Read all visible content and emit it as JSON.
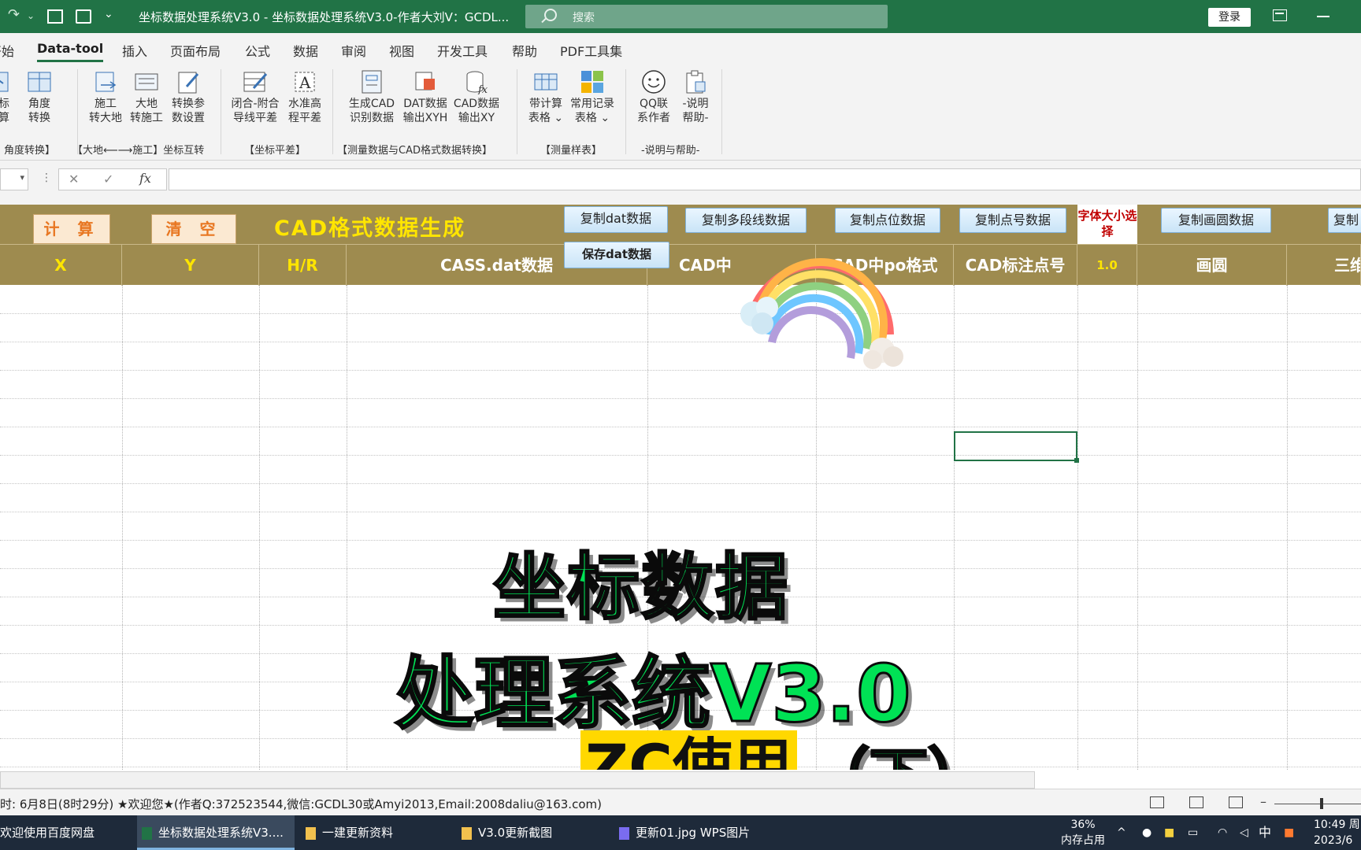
{
  "window": {
    "title": "坐标数据处理系统V3.0  -  坐标数据处理系统V3.0-作者大刘V：GCDL...",
    "search_placeholder": "搜索",
    "login_label": "登录"
  },
  "ribbon_tabs": [
    "开始",
    "Data-tool",
    "插入",
    "页面布局",
    "公式",
    "数据",
    "审阅",
    "视图",
    "开发工具",
    "帮助",
    "PDF工具集"
  ],
  "ribbon": {
    "buttons": [
      {
        "line1": "坐标",
        "line2": "计算"
      },
      {
        "line1": "角度",
        "line2": "转换"
      },
      {
        "line1": "施工",
        "line2": "转大地"
      },
      {
        "line1": "大地",
        "line2": "转施工"
      },
      {
        "line1": "转换参",
        "line2": "数设置"
      },
      {
        "line1": "闭合-附合",
        "line2": "导线平差"
      },
      {
        "line1": "水准高",
        "line2": "程平差"
      },
      {
        "line1": "生成CAD",
        "line2": "识别数据"
      },
      {
        "line1": "DAT数据",
        "line2": "输出XYH"
      },
      {
        "line1": "CAD数据",
        "line2": "输出XY"
      },
      {
        "line1": "带计算",
        "line2": "表格 ⌄"
      },
      {
        "line1": "常用记录",
        "line2": "表格 ⌄"
      },
      {
        "line1": "QQ联",
        "line2": "系作者"
      },
      {
        "line1": "-说明",
        "line2": "帮助-"
      }
    ],
    "groups": [
      "、角度转换】",
      "【大地⟵⟶施工】坐标互转",
      "【坐标平差】",
      "【测量数据与CAD格式数据转换】",
      "【测量样表】",
      "-说明与帮助-"
    ]
  },
  "formula_bar": {
    "fx": "fx",
    "cancel": "✕",
    "enter": "✓"
  },
  "sheet": {
    "calc_button": "计 算",
    "clear_button": "清 空",
    "cad_title": "CAD格式数据生成",
    "copy_buttons": [
      "复制dat数据",
      "复制多段线数据",
      "复制点位数据",
      "复制点号数据",
      "复制画圆数据",
      "复制"
    ],
    "save_dat": "保存dat数据",
    "font_select_label": "字体大小选择",
    "font_size_value": "1.0",
    "headers": [
      "X",
      "Y",
      "H/R",
      "CASS.dat数据",
      "CAD中",
      "CAD中po格式",
      "CAD标注点号",
      "1.0",
      "画圆",
      "三维"
    ]
  },
  "overlay": {
    "line1": "坐标数据",
    "line2": "处理系统V3.0",
    "line3": "ZC使用",
    "line4": "（下）"
  },
  "status": {
    "text": "时:  6月8日(8时29分) ★欢迎您★(作者Q:372523544,微信:GCDL30或Amyi2013,Email:2008daliu@163.com)"
  },
  "taskbar": {
    "items": [
      "欢迎使用百度网盘",
      "坐标数据处理系统V3....",
      "一建更新资料",
      "V3.0更新截图",
      "更新01.jpg  WPS图片"
    ],
    "mem_pct": "36%",
    "mem_label": "内存占用",
    "ime": "中",
    "time": "10:49 周",
    "date": "2023/6"
  },
  "colors": {
    "accent": "#217346",
    "sheet_header": "#9e8b4f",
    "header_text": "#ffe500",
    "overlay_green": "#00e255",
    "overlay_yellow": "#ffd800"
  }
}
